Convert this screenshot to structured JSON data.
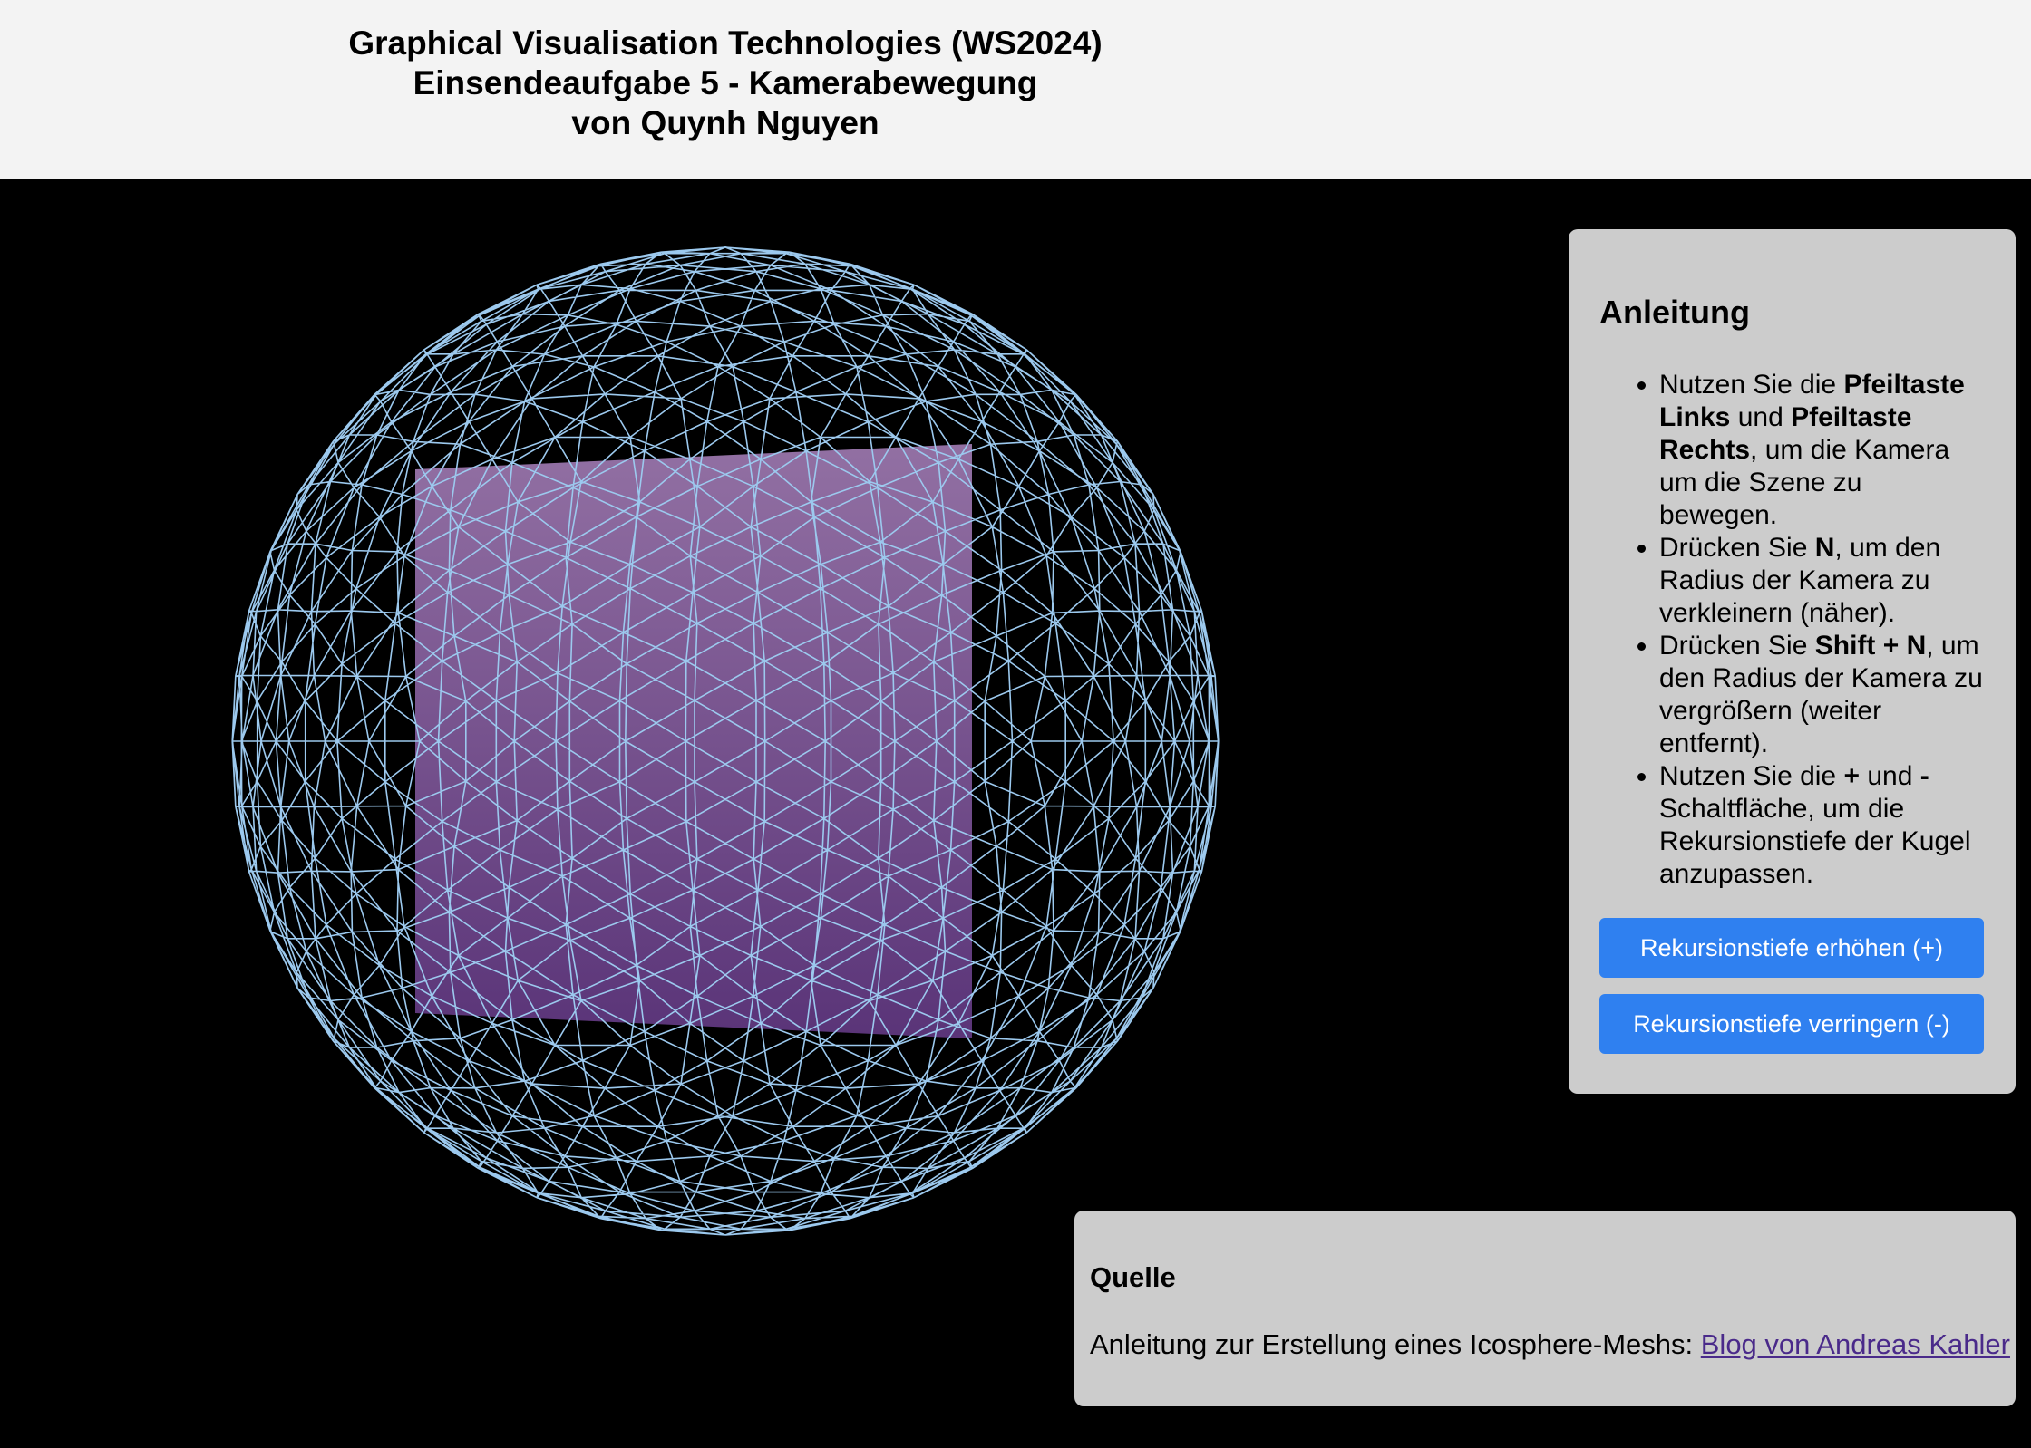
{
  "header": {
    "title_line1": "Graphical Visualisation Technologies (WS2024)",
    "title_line2": "Einsendeaufgabe 5 - Kamerabewegung",
    "title_line3": "von Quynh Nguyen"
  },
  "scene": {
    "background": "#000000",
    "sphere_wire_color": "#9cc9ee",
    "plane_color_top": "#9270a3",
    "plane_color_bottom": "#5a3478"
  },
  "instructions": {
    "heading": "Anleitung",
    "items": [
      {
        "pre": "Nutzen Sie die ",
        "k1": "Pfeiltaste Links",
        "mid": " und ",
        "k2": "Pfeiltaste Rechts",
        "post": ", um die Kamera um die Szene zu bewegen."
      },
      {
        "pre": "Drücken Sie ",
        "k1": "N",
        "post": ", um den Radius der Kamera zu verkleinern (näher)."
      },
      {
        "pre": "Drücken Sie ",
        "k1": "Shift + N",
        "post": ", um den Radius der Kamera zu vergrößern (weiter entfernt)."
      },
      {
        "pre": "Nutzen Sie die ",
        "k1": "+",
        "mid": " und ",
        "k2": "-",
        "post": " Schaltfläche, um die Rekursionstiefe der Kugel anzupassen."
      }
    ],
    "btn_increase": "Rekursionstiefe erhöhen (+)",
    "btn_decrease": "Rekursionstiefe verringern (-)",
    "button_color": "#2f80f0"
  },
  "source": {
    "heading": "Quelle",
    "text": "Anleitung zur Erstellung eines Icosphere-Meshs: ",
    "link_text": "Blog von Andreas Kahler"
  }
}
